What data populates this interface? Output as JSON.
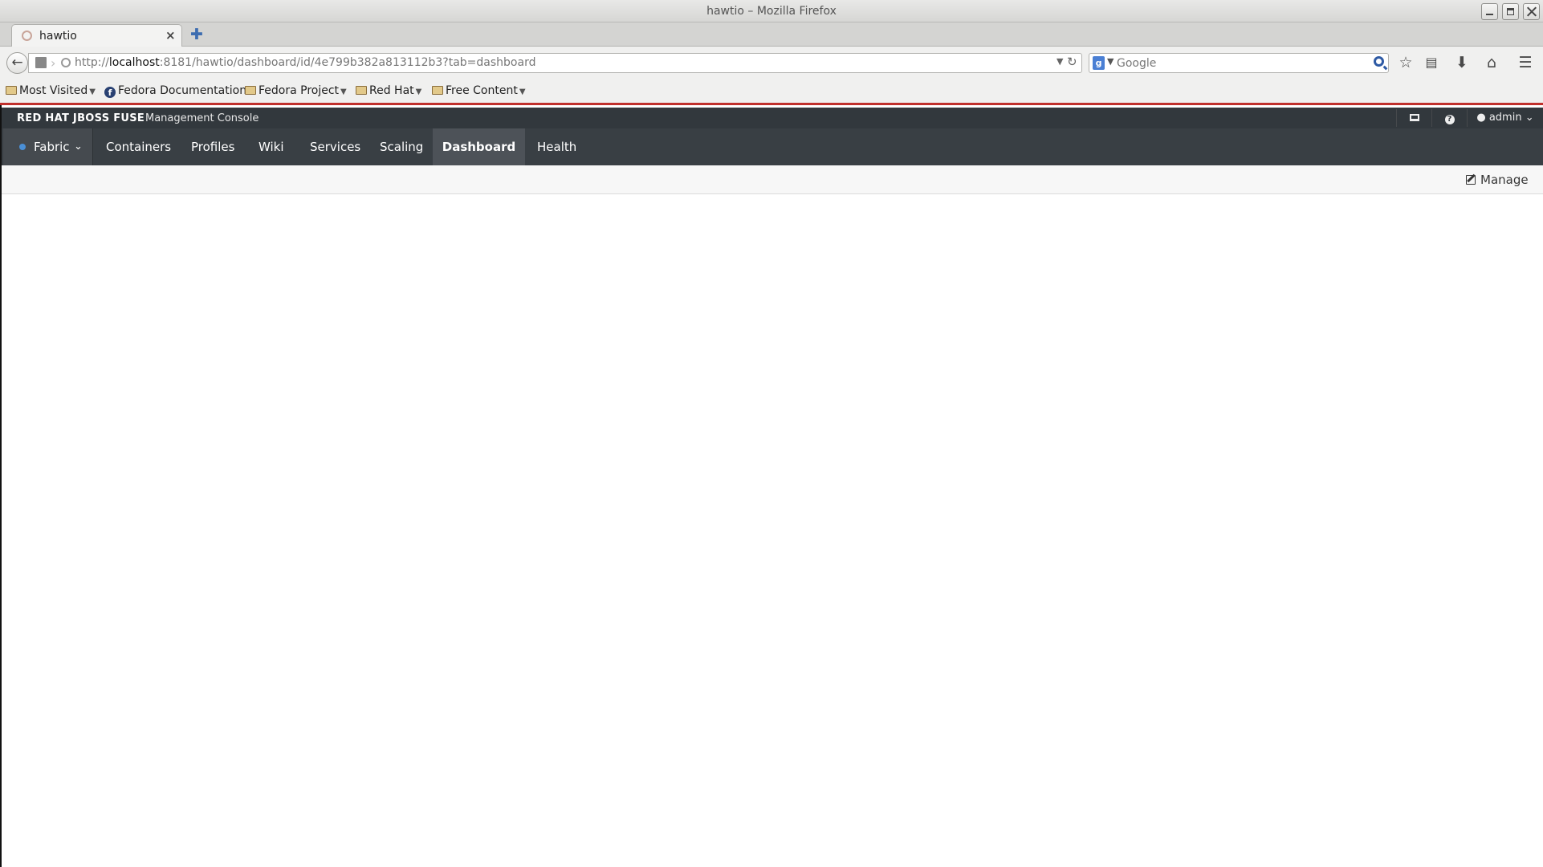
{
  "window": {
    "title": "hawtio – Mozilla Firefox"
  },
  "browser": {
    "tab": {
      "label": "hawtio"
    },
    "url": {
      "prefix": "http://",
      "host": "localhost",
      "rest": ":8181/hawtio/dashboard/id/4e799b382a813112b3?tab=dashboard"
    },
    "search": {
      "placeholder": "Google"
    },
    "toolbar_icons": [
      "star-icon",
      "reading-list-icon",
      "download-icon",
      "home-icon",
      "menu-icon"
    ],
    "bookmarks": [
      {
        "label": "Most Visited",
        "icon": "folder-icon",
        "has_menu": true
      },
      {
        "label": "Fedora Documentation",
        "icon": "fedora-icon",
        "has_menu": false
      },
      {
        "label": "Fedora Project",
        "icon": "folder-icon",
        "has_menu": true
      },
      {
        "label": "Red Hat",
        "icon": "folder-icon",
        "has_menu": true
      },
      {
        "label": "Free Content",
        "icon": "folder-icon",
        "has_menu": true
      }
    ]
  },
  "app": {
    "brand": "RED HAT JBOSS FUSE",
    "subtitle": "Management Console",
    "user": "admin",
    "perspective": "Fabric",
    "nav": [
      {
        "label": "Containers",
        "active": false
      },
      {
        "label": "Profiles",
        "active": false
      },
      {
        "label": "Wiki",
        "active": false
      },
      {
        "label": "Services",
        "active": false
      },
      {
        "label": "Scaling",
        "active": false
      },
      {
        "label": "Dashboard",
        "active": true
      },
      {
        "label": "Health",
        "active": false
      }
    ],
    "manage_label": "Manage"
  }
}
